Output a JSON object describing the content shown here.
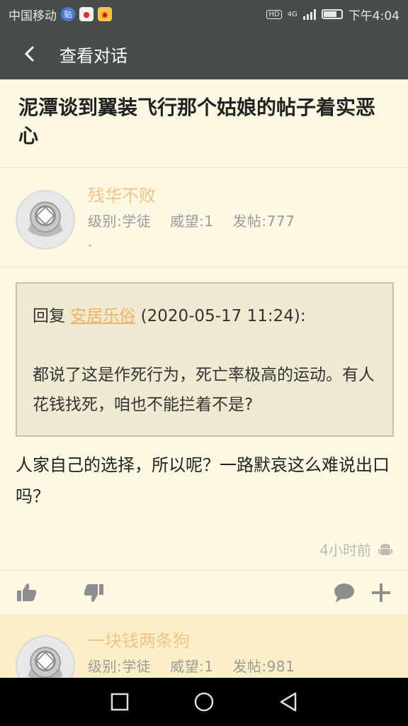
{
  "status_bar": {
    "carrier": "中国移动",
    "network": "4G",
    "hd_label": "HD",
    "time": "下午4:04",
    "icons": [
      "tieba-icon",
      "map-icon",
      "weibo-icon"
    ]
  },
  "appbar": {
    "title": "查看对话",
    "back_icon": "chevron-left-icon"
  },
  "thread": {
    "title": "泥潭谈到翼装飞行那个姑娘的帖子着实恶心"
  },
  "post1": {
    "author": "残华不败",
    "level": "级别:学徒",
    "prestige": "威望:1",
    "posts": "发帖:777",
    "signature": "-",
    "quote": {
      "prefix": "回复",
      "name": "安居乐俗",
      "time": "(2020-05-17 11:24):",
      "text": "都说了这是作死行为，死亡率极高的运动。有人花钱找死，咱也不能拦着不是?"
    },
    "body": "人家自己的选择，所以呢？一路默哀这么难说出口吗？",
    "time_ago": "4小时前"
  },
  "post2": {
    "author": "一块钱两条狗",
    "level": "级别:学徒",
    "prestige": "威望:1",
    "posts": "发帖:981"
  },
  "colors": {
    "bar": "#474d4d",
    "page_bg": "#fdf8e4",
    "username": "#efc486",
    "quote_bg": "#efe9d2"
  }
}
